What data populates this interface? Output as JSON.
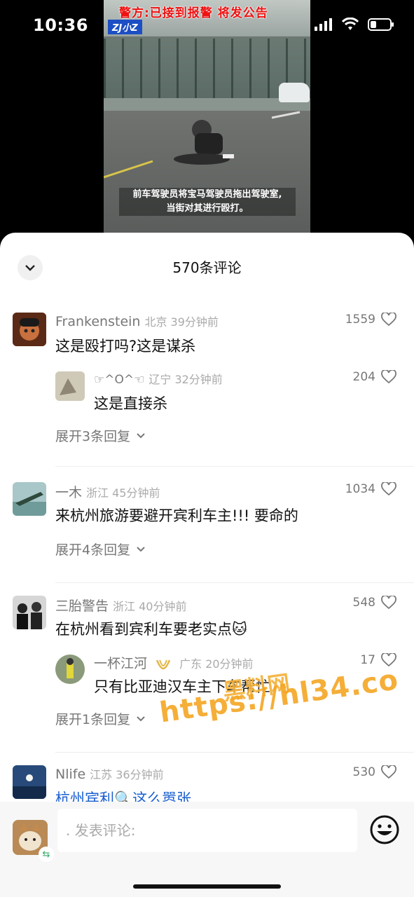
{
  "status_bar": {
    "time": "10:36"
  },
  "video": {
    "title": "警方:已接到报警 将发公告",
    "logo": "ZJ小Z",
    "subtitle_line1": "前车驾驶员将宝马驾驶员拖出驾驶室,",
    "subtitle_line2": "当街对其进行殴打。"
  },
  "sheet": {
    "title": "570条评论"
  },
  "comments": [
    {
      "user": "Frankenstein",
      "location": "北京 39分钟前",
      "text": "这是殴打吗?这是谋杀",
      "likes": "1559",
      "reply": {
        "user": "☞^O^☜",
        "location": "辽宁 32分钟前",
        "text": "这是直接杀",
        "likes": "204"
      },
      "expand_label": "展开3条回复"
    },
    {
      "user": "一木",
      "location": "浙江 45分钟前",
      "text": "来杭州旅游要避开宾利车主!!! 要命的",
      "likes": "1034",
      "expand_label": "展开4条回复"
    },
    {
      "user": "三胎警告",
      "location": "浙江 40分钟前",
      "text": "在杭州看到宾利车要老实点🐱",
      "likes": "548",
      "reply": {
        "user": "一杯江河",
        "location": "广东 20分钟前",
        "text": "只有比亚迪汉车主下车帮忙",
        "likes": "17"
      },
      "expand_label": "展开1条回复"
    },
    {
      "user": "Nlife",
      "location": "江苏 36分钟前",
      "text": "杭州宾利🔍这么嚣张",
      "likes": "530"
    }
  ],
  "input": {
    "placeholder": ". 发表评论:"
  },
  "watermark": {
    "cn": "黑料网",
    "url": "https://hl34.co"
  },
  "colors": {
    "accent_blue": "#1a5fcf",
    "watermark_orange": "#f5a623",
    "muted_text": "#777777"
  }
}
